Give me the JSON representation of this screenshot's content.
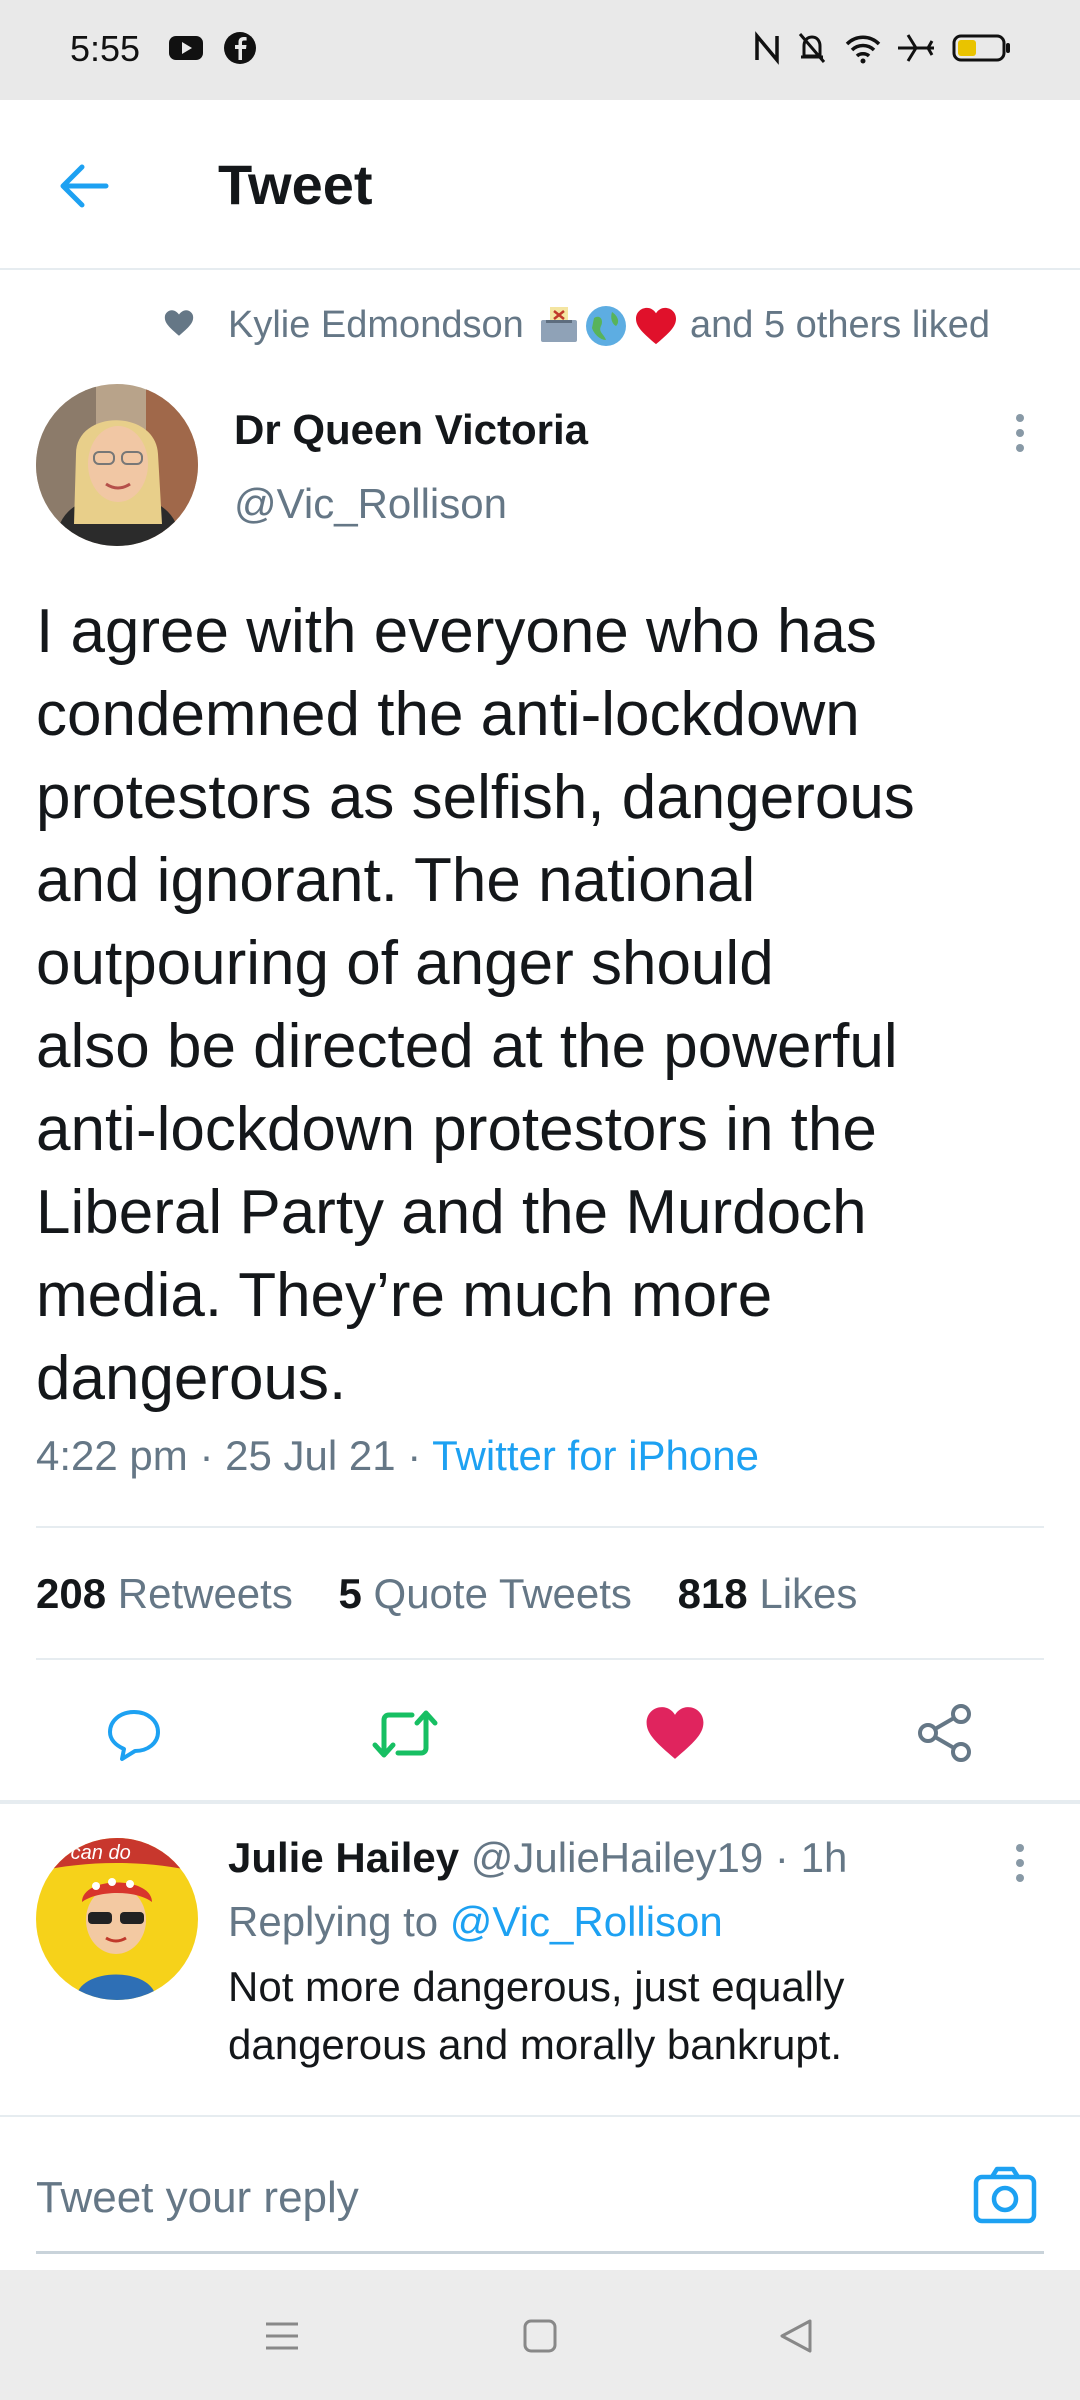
{
  "status_bar": {
    "time": "5:55",
    "left_icons": [
      "youtube-icon",
      "facebook-icon"
    ],
    "right_icons": [
      "nfc-icon",
      "bell-off-icon",
      "wifi-icon",
      "airplane-icon",
      "battery-icon"
    ]
  },
  "header": {
    "back_icon": "arrow-left-icon",
    "title": "Tweet"
  },
  "social_context": {
    "icon": "heart-icon",
    "name": "Kylie Edmondson",
    "emojis": [
      "ballot-box-emoji",
      "globe-emoji",
      "red-heart-emoji"
    ],
    "suffix": "and 5 others liked"
  },
  "tweet": {
    "author_name": "Dr Queen Victoria",
    "author_handle": "@Vic_Rollison",
    "text": "I agree with everyone who has\ncondemned the anti-lockdown\nprotestors as selfish, dangerous\nand ignorant. The national\noutpouring of anger should\nalso be directed at the powerful\nanti-lockdown protestors in the\nLiberal Party and the Murdoch\nmedia. They’re much more\ndangerous.",
    "time": "4:22 pm",
    "date": "25 Jul 21",
    "separator": "·",
    "source": "Twitter for iPhone",
    "stats": {
      "retweets_count": "208",
      "retweets_label": "Retweets",
      "quotes_count": "5",
      "quotes_label": "Quote Tweets",
      "likes_count": "818",
      "likes_label": "Likes"
    },
    "actions": [
      "reply-icon",
      "retweet-icon",
      "like-icon",
      "share-icon"
    ],
    "colors": {
      "retweet": "#17bf63",
      "like": "#e0245e",
      "link": "#1da1f2"
    }
  },
  "reply": {
    "avatar_text": "u can do",
    "author_name": "Julie Hailey",
    "author_handle": "@JulieHailey19",
    "separator": "·",
    "time": "1h",
    "replying_prefix": "Replying to",
    "replying_handle": "@Vic_Rollison",
    "text": "Not more dangerous, just equally\ndangerous and morally bankrupt."
  },
  "composer": {
    "placeholder": "Tweet your reply",
    "camera_icon": "camera-icon"
  },
  "nav_bar": {
    "icons": [
      "menu-icon",
      "home-square-icon",
      "back-triangle-icon"
    ]
  }
}
